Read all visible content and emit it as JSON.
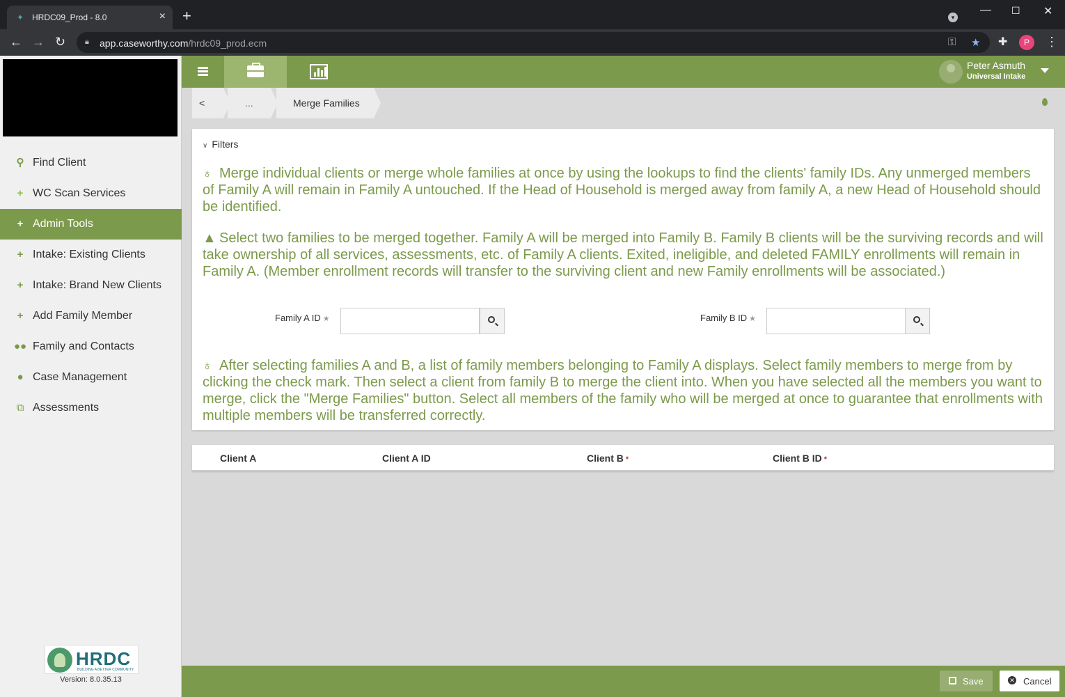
{
  "browser": {
    "tab_title": "HRDC09_Prod - 8.0",
    "url_host": "app.caseworthy.com",
    "url_path": "/hrdc09_prod.ecm",
    "profile_initial": "P"
  },
  "sidebar": {
    "items": [
      {
        "label": "Find Client",
        "icon": "search-icon"
      },
      {
        "label": "WC Scan Services",
        "icon": "plus-icon"
      },
      {
        "label": "Admin Tools",
        "icon": "plus-icon",
        "active": true
      },
      {
        "label": "Intake: Existing Clients",
        "icon": "plus-icon"
      },
      {
        "label": "Intake: Brand New Clients",
        "icon": "plus-icon"
      },
      {
        "label": "Add Family Member",
        "icon": "plus-icon"
      },
      {
        "label": "Family and Contacts",
        "icon": "users-icon"
      },
      {
        "label": "Case Management",
        "icon": "user-icon"
      },
      {
        "label": "Assessments",
        "icon": "assessment-icon"
      }
    ],
    "logo_text": "HRDC",
    "logo_subtext": "BUILDING A BETTER COMMUNITY",
    "version": "Version: 8.0.35.13"
  },
  "topbar": {
    "user_name": "Peter Asmuth",
    "user_role": "Universal Intake"
  },
  "breadcrumb": {
    "back": "<",
    "ellipsis": "...",
    "current": "Merge Families"
  },
  "panel": {
    "filters_label": "Filters",
    "info1": "Merge individual clients or merge whole families at once by using the lookups to find the clients' family IDs. Any unmerged members of Family A will remain in Family A untouched. If the Head of Household is merged away from family A, a new Head of Household should be identified.",
    "warning": "Select two families to be merged together. Family A will be merged into Family B. Family B clients will be the surviving records and will take ownership of all services, assessments, etc. of Family A clients. Exited, ineligible, and deleted FAMILY enrollments will remain in Family A. (Member enrollment records will transfer to the surviving client and new Family enrollments will be associated.)",
    "family_a_label": "Family A ID",
    "family_a_value": "",
    "family_b_label": "Family B ID",
    "family_b_value": "",
    "info2": "After selecting families A and B, a list of family members belonging to Family A displays. Select family members to merge from by clicking the check mark. Then select a client from family B to merge the client into. When you have selected all the members you want to merge, click the \"Merge Families\" button. Select all members of the family who will be merged at once to guarantee that enrollments with multiple members will be transferred correctly."
  },
  "grid": {
    "columns": [
      "Client A",
      "Client A ID",
      "Client B",
      "Client B ID"
    ]
  },
  "footer": {
    "save_label": "Save",
    "cancel_label": "Cancel"
  },
  "colors": {
    "brand_green": "#7c9a4b",
    "sidebar_bg": "#f0f0f0"
  }
}
